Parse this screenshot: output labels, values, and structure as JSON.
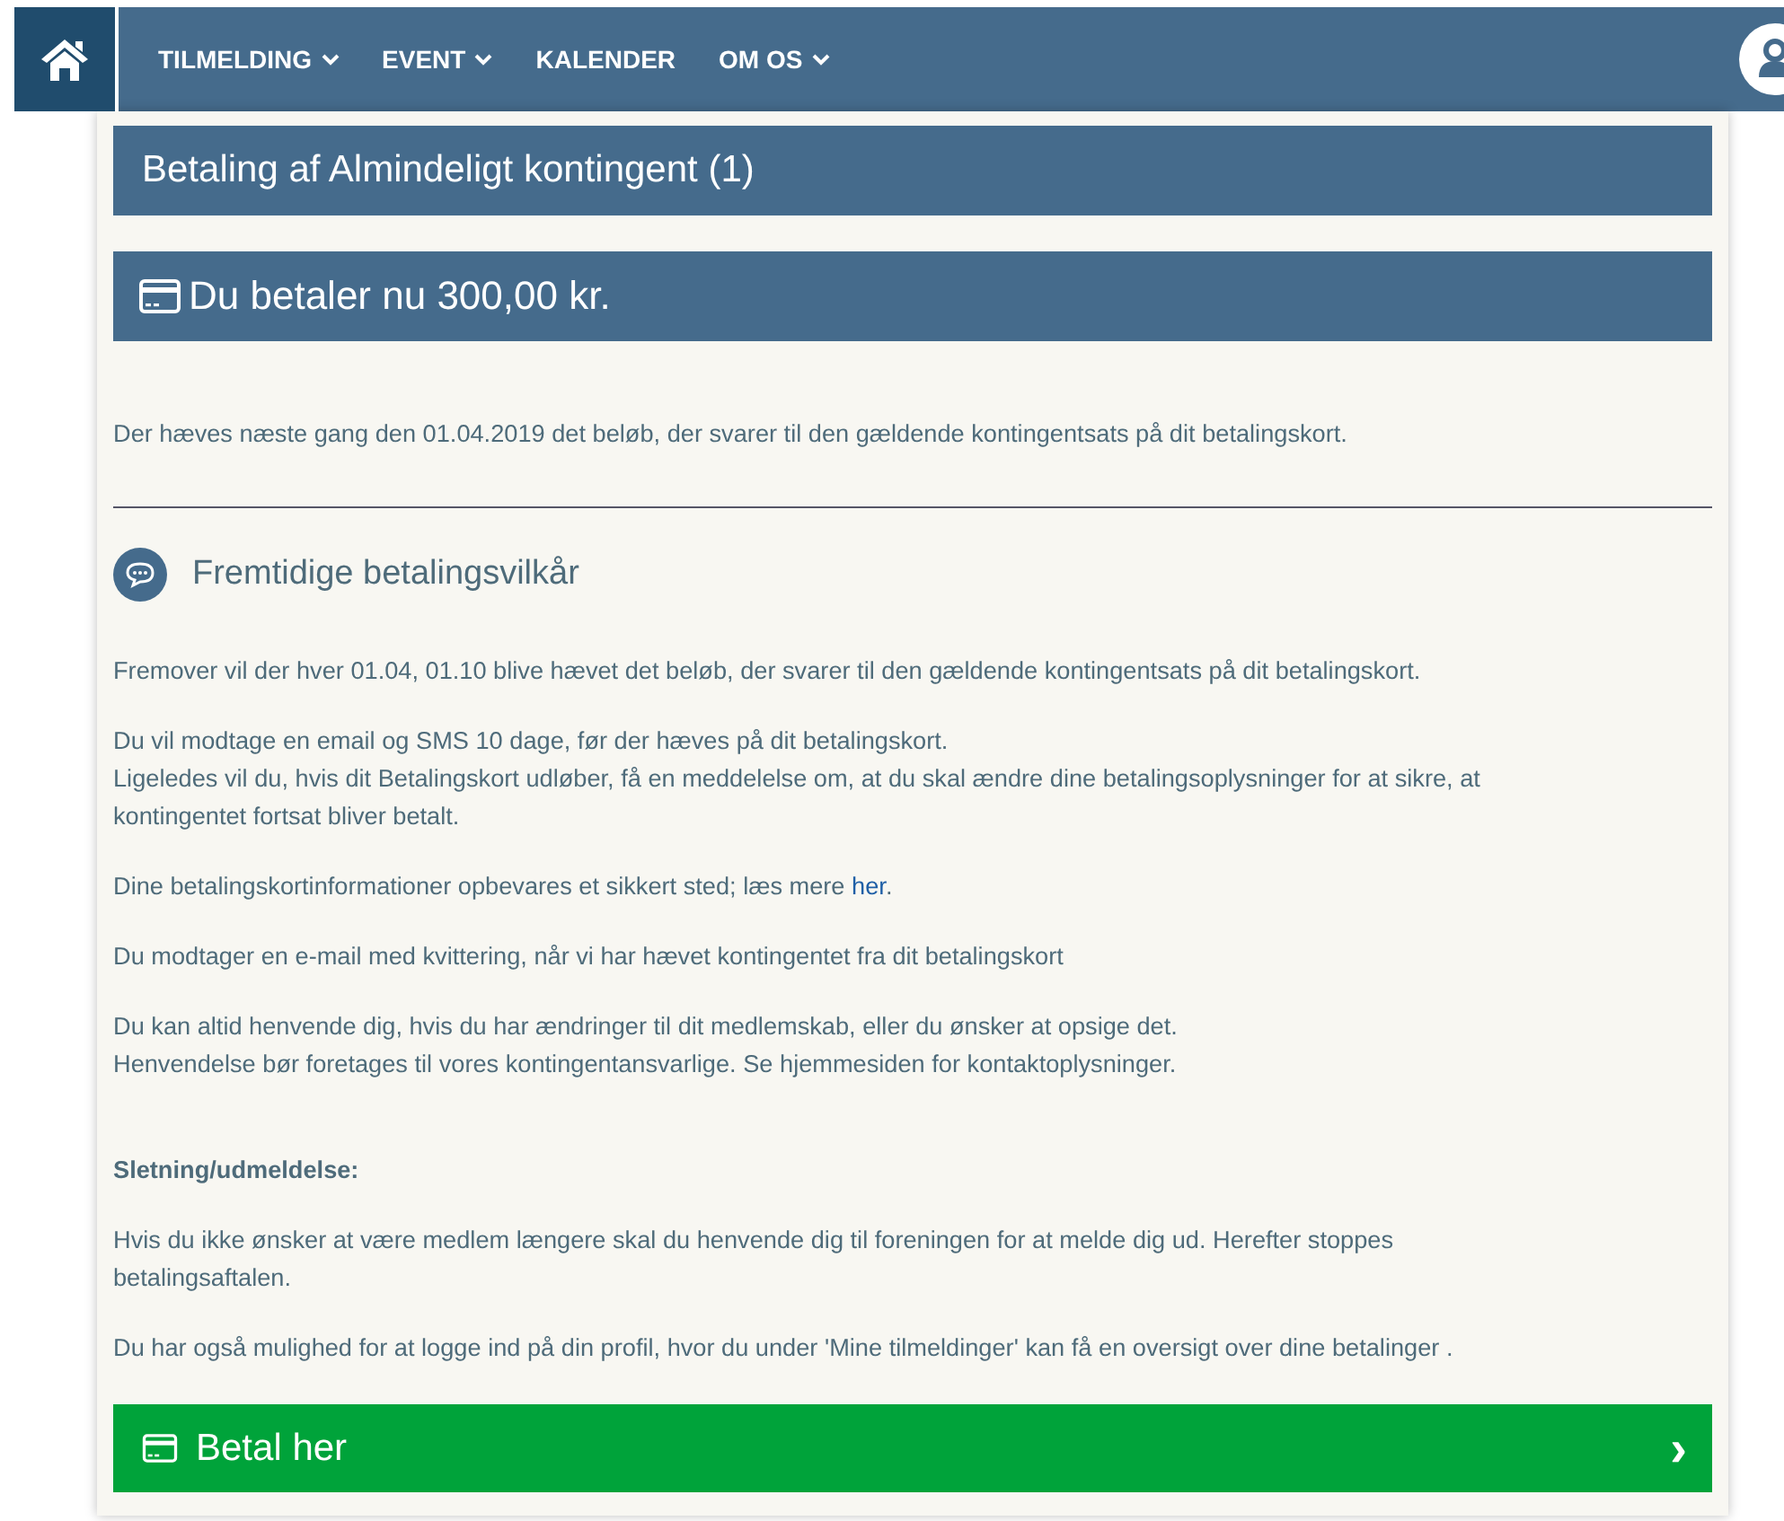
{
  "nav": {
    "items": [
      {
        "label": "TILMELDING",
        "dropdown": true
      },
      {
        "label": "EVENT",
        "dropdown": true
      },
      {
        "label": "KALENDER",
        "dropdown": false
      },
      {
        "label": "OM OS",
        "dropdown": true
      }
    ]
  },
  "title": "Betaling af Almindeligt kontingent (1)",
  "amount_banner": "Du betaler nu 300,00 kr.",
  "notice": "Der hæves næste gang den 01.04.2019 det beløb, der svarer til den gældende kontingentsats på dit betalingskort.",
  "section_heading": "Fremtidige betalingsvilkår",
  "paragraphs": [
    {
      "kind": "text",
      "lines": [
        "Fremover vil der hver 01.04, 01.10 blive hævet det beløb, der svarer til den gældende kontingentsats på dit betalingskort."
      ]
    },
    {
      "kind": "text",
      "lines": [
        "Du vil modtage en email og SMS 10 dage, før der hæves på dit betalingskort.",
        "Ligeledes vil du, hvis dit Betalingskort udløber, få en meddelelse om, at du skal ændre dine betalingsoplysninger for at sikre, at",
        "kontingentet fortsat bliver betalt."
      ]
    },
    {
      "kind": "link",
      "before": "Dine betalingskortinformationer opbevares et sikkert sted; læs mere ",
      "link": "her",
      "after": "."
    },
    {
      "kind": "text",
      "lines": [
        "Du modtager en e-mail med kvittering, når vi har hævet kontingentet fra dit betalingskort"
      ]
    },
    {
      "kind": "text",
      "lines": [
        "Du kan altid henvende dig, hvis du har ændringer til dit medlemskab, eller du ønsker at opsige det.",
        "Henvendelse bør foretages til vores kontingentansvarlige. Se hjemmesiden for kontaktoplysninger."
      ]
    },
    {
      "kind": "heading",
      "text": "Sletning/udmeldelse:"
    },
    {
      "kind": "text",
      "lines": [
        "Hvis du ikke ønsker at være medlem længere skal du henvende dig til foreningen for at melde dig ud. Herefter stoppes",
        "betalingsaftalen."
      ]
    },
    {
      "kind": "text",
      "lines": [
        "Du har også mulighed for at logge ind på din profil, hvor du under 'Mine tilmeldinger' kan få en oversigt over dine betalinger ."
      ]
    }
  ],
  "pay_button": {
    "label": "Betal her",
    "arrow": "›"
  }
}
